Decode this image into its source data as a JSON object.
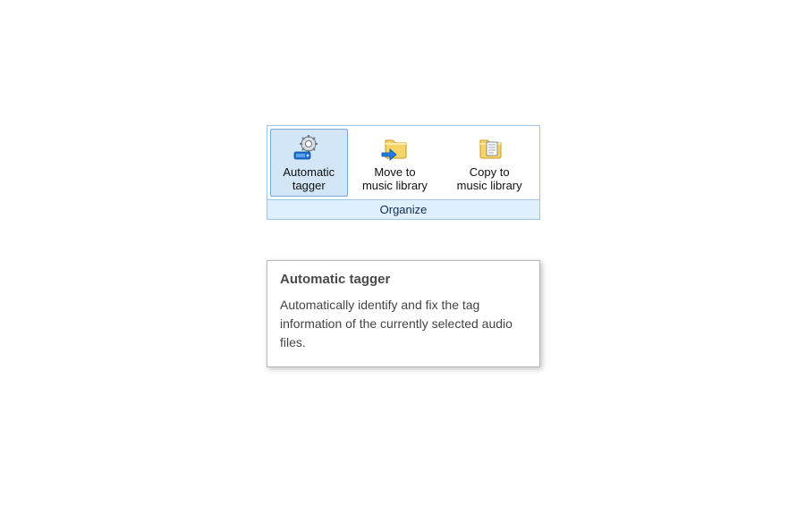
{
  "ribbon": {
    "group_label": "Organize",
    "buttons": {
      "automatic_tagger": {
        "label": "Automatic\ntagger",
        "selected": true
      },
      "move_to_library": {
        "label": "Move to\nmusic library",
        "selected": false
      },
      "copy_to_library": {
        "label": "Copy to\nmusic library",
        "selected": false
      }
    }
  },
  "tooltip": {
    "title": "Automatic tagger",
    "body": "Automatically identify and fix the tag information of the currently selected audio files."
  }
}
